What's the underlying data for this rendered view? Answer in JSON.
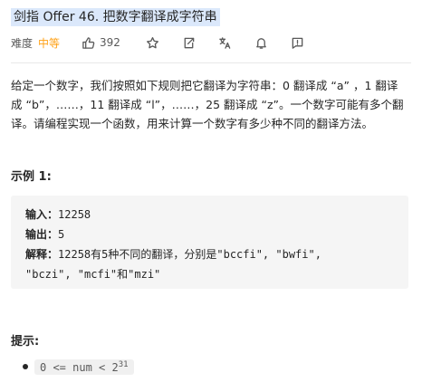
{
  "problem": {
    "title": "剑指 Offer 46. 把数字翻译成字符串",
    "difficulty_label": "难度",
    "difficulty_value": "中等",
    "likes": "392"
  },
  "icons": [
    "thumbs-up-icon",
    "star-icon",
    "share-icon",
    "translate-icon",
    "bell-icon",
    "feedback-icon"
  ],
  "description": {
    "lines": [
      "给定一个数字，我们按照如下规则把它翻译为字符串：0 翻译成 “a” ，1 翻译",
      "成 “b”，……，11 翻译成 “l”，……，25 翻译成 “z”。一个数字可能有多个翻",
      "译。请编程实现一个函数，用来计算一个数字有多少种不同的翻译方法。"
    ]
  },
  "example": {
    "title": "示例 1:",
    "input_label": "输入：",
    "input_value": "12258",
    "output_label": "输出：",
    "output_value": "5",
    "explain_label": "解释：",
    "explain_line1": "12258有5种不同的翻译，分别是\"bccfi\", \"bwfi\",",
    "explain_line2": "\"bczi\", \"mcfi\"和\"mzi\""
  },
  "hints": {
    "title": "提示:",
    "constraint_base": "0 <= num < 2",
    "constraint_exp": "31"
  },
  "colors": {
    "difficulty_medium": "#ffa116",
    "title_highlight": "#dbe8fb"
  }
}
